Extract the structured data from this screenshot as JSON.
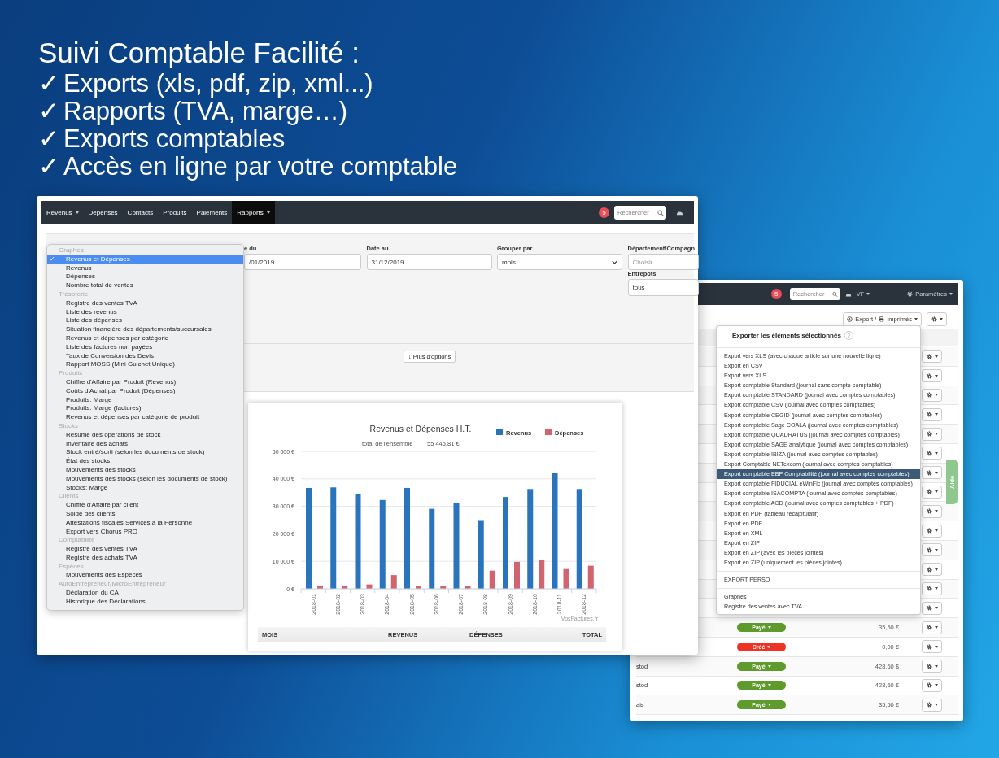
{
  "headline": {
    "title": "Suivi Comptable Facilité :",
    "points": [
      {
        "mark": "✓",
        "text": "Exports (xls, pdf, zip, xml...)"
      },
      {
        "mark": "✓",
        "text": "Rapports (TVA, marge…)"
      },
      {
        "mark": "✓",
        "text": "Exports comptables"
      },
      {
        "mark": "✓",
        "text": "Accès en ligne par votre comptable"
      }
    ]
  },
  "reports_window": {
    "nav": [
      {
        "label": "Revenus",
        "dropdown": true,
        "selected": false
      },
      {
        "label": "Dépenses",
        "dropdown": false,
        "selected": false
      },
      {
        "label": "Contacts",
        "dropdown": false,
        "selected": false
      },
      {
        "label": "Produits",
        "dropdown": false,
        "selected": false
      },
      {
        "label": "Paiements",
        "dropdown": false,
        "selected": false
      },
      {
        "label": "Rapports",
        "dropdown": true,
        "selected": true
      }
    ],
    "notification_badge": "5",
    "search": {
      "placeholder": "Rechercher"
    },
    "filters": [
      {
        "label": "e du",
        "value": "/01/2019",
        "kind": "text"
      },
      {
        "label": "Date au",
        "value": "31/12/2019",
        "kind": "text"
      },
      {
        "label": "Grouper par",
        "value": "mois",
        "kind": "select"
      },
      {
        "label": "Département/Compagn",
        "placeholder": "Choisir...",
        "kind": "text"
      }
    ],
    "warehouse": {
      "label": "Entrepôts",
      "value": "tous"
    },
    "more_button": "↓ Plus d'options",
    "report_menu": {
      "check": "✓",
      "groups": [
        {
          "heading": "Graphes",
          "items": [
            {
              "label": "Revenus et Dépenses",
              "selected": true
            },
            {
              "label": "Revenus",
              "selected": false
            },
            {
              "label": "Dépenses",
              "selected": false
            },
            {
              "label": "Nombre total de ventes",
              "selected": false
            }
          ]
        },
        {
          "heading": "Trésorerie",
          "items": [
            {
              "label": "Registre des ventes TVA",
              "selected": false
            },
            {
              "label": "Liste des revenus",
              "selected": false
            },
            {
              "label": "Liste des dépenses",
              "selected": false
            },
            {
              "label": "Situation financière des départements/succursales",
              "selected": false
            },
            {
              "label": "Revenus et dépenses par catégorie",
              "selected": false
            },
            {
              "label": "Liste des factures non payées",
              "selected": false
            },
            {
              "label": "Taux de Conversion des Devis",
              "selected": false
            },
            {
              "label": "Rapport MOSS (Mini Guichet Unique)",
              "selected": false
            }
          ]
        },
        {
          "heading": "Produits",
          "items": [
            {
              "label": "Chiffre d'Affaire par Produit (Revenus)",
              "selected": false
            },
            {
              "label": "Coûts d'Achat par Produit (Dépenses)",
              "selected": false
            },
            {
              "label": "Produits: Marge",
              "selected": false
            },
            {
              "label": "Produits: Marge (factures)",
              "selected": false
            },
            {
              "label": "Revenus et dépenses par catégorie de produit",
              "selected": false
            }
          ]
        },
        {
          "heading": "Stocks",
          "items": [
            {
              "label": "Résumé des opérations de stock",
              "selected": false
            },
            {
              "label": "Inventaire des achats",
              "selected": false
            },
            {
              "label": "Stock entré/sorti (selon les documents de stock)",
              "selected": false
            },
            {
              "label": "État des stocks",
              "selected": false
            },
            {
              "label": "Mouvements des stocks",
              "selected": false
            },
            {
              "label": "Mouvements des stocks (selon les documents de stock)",
              "selected": false
            },
            {
              "label": "Stocks: Marge",
              "selected": false
            }
          ]
        },
        {
          "heading": "Clients",
          "items": [
            {
              "label": "Chiffre d'Affaire par client",
              "selected": false
            },
            {
              "label": "Solde des clients",
              "selected": false
            },
            {
              "label": "Attestations fiscales Services à la Personne",
              "selected": false
            },
            {
              "label": "Export vers Chorus PRO",
              "selected": false
            }
          ]
        },
        {
          "heading": "Comptabilité",
          "items": [
            {
              "label": "Registre des ventes TVA",
              "selected": false
            },
            {
              "label": "Registre des achats TVA",
              "selected": false
            }
          ]
        },
        {
          "heading": "Espèces",
          "items": [
            {
              "label": "Mouvements des Espèces",
              "selected": false
            }
          ]
        },
        {
          "heading": "AutoEntrepreneur/MicroEntrepreneur",
          "items": [
            {
              "label": "Déclaration du CA",
              "selected": false
            },
            {
              "label": "Historique des Déclarations",
              "selected": false
            }
          ]
        }
      ]
    },
    "chart": {
      "chart_data": {
        "type": "bar",
        "title": "Revenus et Dépenses H.T.",
        "categories": [
          "2018-01",
          "2018-02",
          "2018-03",
          "2018-04",
          "2018-05",
          "2018-06",
          "2018-07",
          "2018-08",
          "2018-09",
          "2018-10",
          "2018-11",
          "2018-12"
        ],
        "series": [
          {
            "name": "Revenus",
            "color": "#2a74bd",
            "values": [
              36700,
              36900,
              34500,
              32300,
              36700,
              29100,
              31300,
              25000,
              33400,
              36300,
              42200,
              36300
            ]
          },
          {
            "name": "Dépenses",
            "color": "#d0646f",
            "values": [
              1200,
              1200,
              1600,
              5000,
              1000,
              900,
              900,
              6600,
              9800,
              10400,
              7200,
              8400
            ]
          }
        ],
        "ylim": [
          0,
          50000
        ],
        "grid": true,
        "legend": true,
        "yticks": [
          {
            "value": 0,
            "label": "0 €"
          },
          {
            "value": 10000,
            "label": "10 000 €"
          },
          {
            "value": 20000,
            "label": "20 000 €"
          },
          {
            "value": 30000,
            "label": "30 000 €"
          },
          {
            "value": 40000,
            "label": "40 000 €"
          },
          {
            "value": 50000,
            "label": "50 000 €"
          }
        ]
      },
      "subtitle_label": "total de l'ensemble",
      "subtitle_value": "55 445,81 €",
      "credit": "VosFactures.fr"
    },
    "table_columns": [
      "MOIS",
      "REVENUS",
      "DÉPENSES",
      "TOTAL"
    ]
  },
  "invoices_window": {
    "notification_badge": "5",
    "search": {
      "placeholder": "Rechercher"
    },
    "account": "VF",
    "settings": "Paramètres",
    "export_button": [
      "Export /",
      "Imprimés"
    ],
    "export_menu": {
      "title": "Exporter les éléments sélectionnés",
      "help": "?",
      "groups": [
        [
          {
            "label": "Export vers XLS (avec chaque article sur une nouvelle ligne)",
            "selected": false
          },
          {
            "label": "Export en CSV",
            "selected": false
          },
          {
            "label": "Export vers XLS",
            "selected": false
          },
          {
            "label": "Export comptable Standard (journal sans compte comptable)",
            "selected": false
          },
          {
            "label": "Export comptable STANDARD (journal avec comptes comptables)",
            "selected": false
          },
          {
            "label": "Export comptable CSV (journal avec comptes comptables)",
            "selected": false
          },
          {
            "label": "Export comptable CEGID (journal avec comptes comptables)",
            "selected": false
          },
          {
            "label": "Export comptable Sage COALA (journal avec comptes comptables)",
            "selected": false
          },
          {
            "label": "Export comptable QUADRATUS (journal avec comptes comptables)",
            "selected": false
          },
          {
            "label": "Export comptable SAGE analytique (journal avec comptes comptables)",
            "selected": false
          },
          {
            "label": "Export comptable IBIZA (journal avec comptes comptables)",
            "selected": false
          },
          {
            "label": "Export Comptable NETexcom (journal avec comptes comptables)",
            "selected": false
          },
          {
            "label": "Export comptable EBP Comptabilité (journal avec comptes comptables)",
            "selected": true
          },
          {
            "label": "Export comptable FIDUCIAL eWinFic (journal avec comptes comptables)",
            "selected": false
          },
          {
            "label": "Export comptable ISACOMPTA (journal avec comptes comptables)",
            "selected": false
          },
          {
            "label": "Export comptable ACD (journal avec comptes comptables + PDF)",
            "selected": false
          },
          {
            "label": "Export en PDF (tableau récapitulatif)",
            "selected": false
          },
          {
            "label": "Export en PDF",
            "selected": false
          },
          {
            "label": "Export en XML",
            "selected": false
          },
          {
            "label": "Export en ZIP",
            "selected": false
          },
          {
            "label": "Export en ZIP (avec les pièces jointes)",
            "selected": false
          },
          {
            "label": "Export en ZIP (uniquement les pièces jointes)",
            "selected": false
          }
        ],
        [
          {
            "label": "EXPORT PERSO",
            "selected": false
          }
        ],
        [
          {
            "label": "Graphes",
            "selected": false
          },
          {
            "label": "Registre des ventes avec TVA",
            "selected": false
          }
        ]
      ]
    },
    "rows": [
      {
        "kind": "covered"
      },
      {
        "kind": "covered"
      },
      {
        "kind": "covered"
      },
      {
        "kind": "covered"
      },
      {
        "kind": "covered"
      },
      {
        "kind": "covered"
      },
      {
        "kind": "covered"
      },
      {
        "kind": "covered"
      },
      {
        "kind": "covered"
      },
      {
        "kind": "covered"
      },
      {
        "kind": "covered"
      },
      {
        "kind": "covered"
      },
      {
        "kind": "covered"
      },
      {
        "kind": "covered"
      },
      {
        "kind": "invoice",
        "status": "Payé",
        "color": "#5e9a2c",
        "amount": "35,50 €"
      },
      {
        "kind": "invoice",
        "status": "Créé",
        "color": "#ee3322",
        "amount": "0,00 €"
      },
      {
        "kind": "invoice",
        "client": "stod",
        "status": "Payé",
        "color": "#5e9a2c",
        "amount": "428,60 $"
      },
      {
        "kind": "invoice",
        "client": "stod",
        "status": "Payé",
        "color": "#5e9a2c",
        "amount": "428,60 €"
      },
      {
        "kind": "invoice",
        "client": "ais",
        "status": "Payé",
        "color": "#5e9a2c",
        "amount": "35,50 €"
      }
    ],
    "help_tab": "Aide"
  }
}
